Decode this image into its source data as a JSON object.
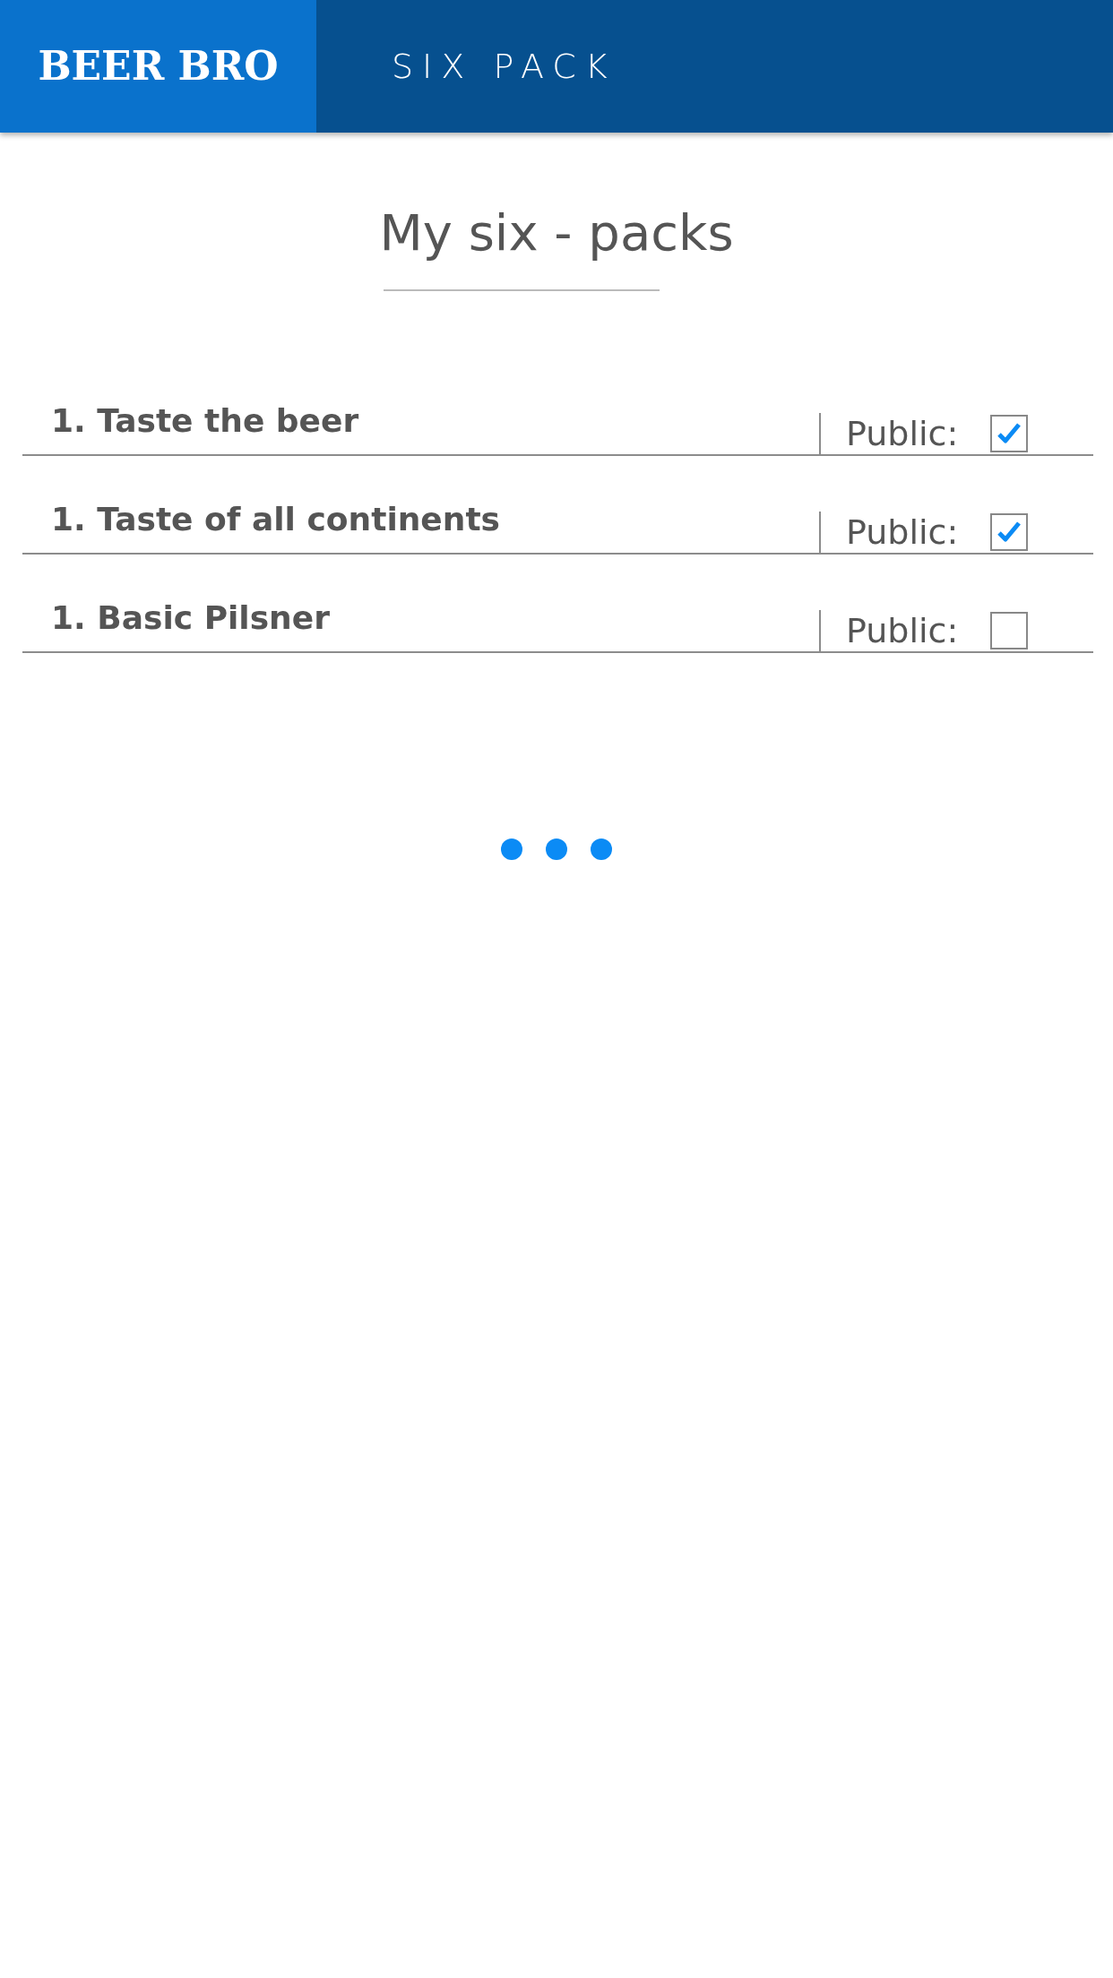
{
  "header": {
    "logo": "BEER BRO",
    "title": "SIX PACK"
  },
  "page_title": "My six - packs",
  "six_packs": [
    {
      "title": "1. Taste the beer",
      "public_label": "Public:",
      "checked": true
    },
    {
      "title": "1. Taste of all continents",
      "public_label": "Public:",
      "checked": true
    },
    {
      "title": "1. Basic Pilsner",
      "public_label": "Public:",
      "checked": false
    }
  ]
}
